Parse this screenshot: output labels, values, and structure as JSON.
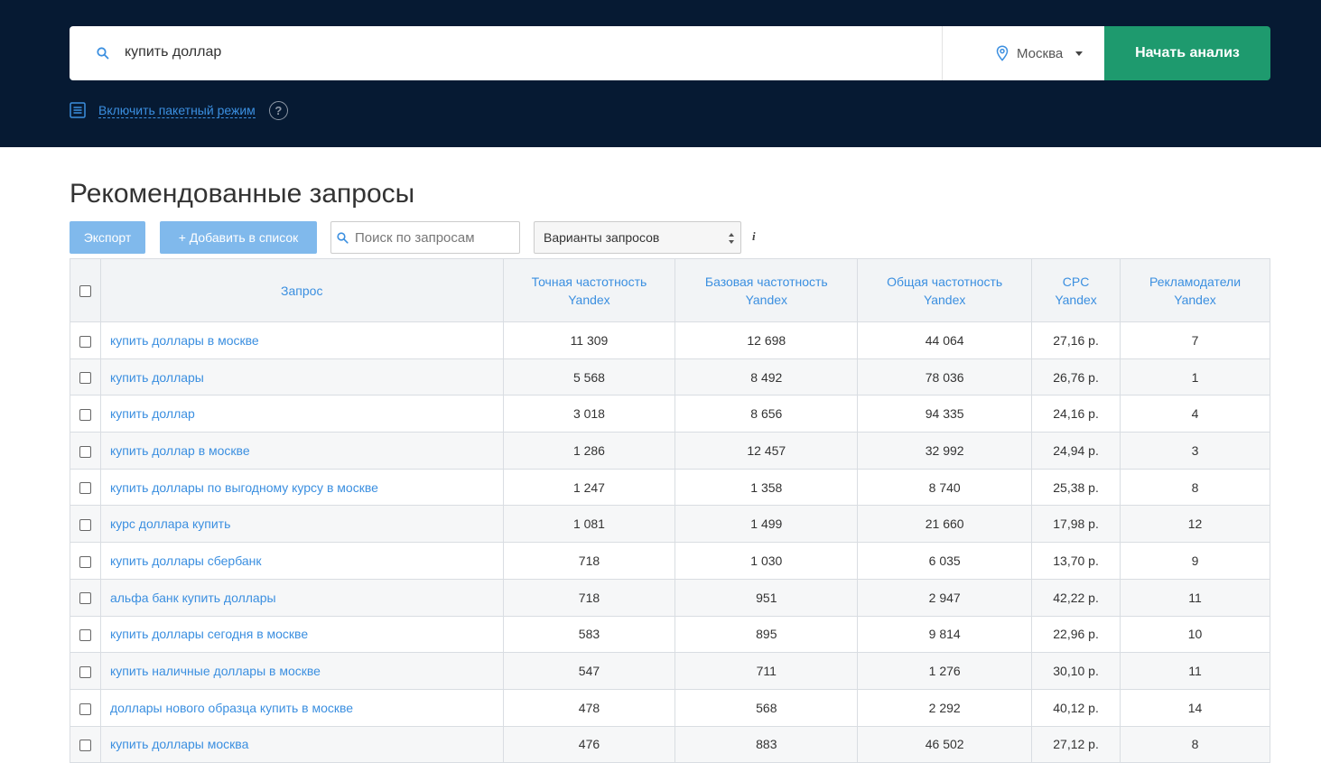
{
  "header": {
    "search_query": "купить доллар",
    "region": "Москва",
    "start_button": "Начать анализ",
    "batch_mode_link": "Включить пакетный режим",
    "help_symbol": "?"
  },
  "section": {
    "title": "Рекомендованные запросы"
  },
  "toolbar": {
    "export_label": "Экспорт",
    "add_to_list_label": "+ Добавить в список",
    "filter_placeholder": "Поиск по запросам",
    "variants_selected": "Варианты запросов",
    "info_symbol": "i"
  },
  "table": {
    "columns": {
      "query": "Запрос",
      "exact_line1": "Точная частотность",
      "exact_line2": "Yandex",
      "base_line1": "Базовая частотность",
      "base_line2": "Yandex",
      "total_line1": "Общая частотность",
      "total_line2": "Yandex",
      "cpc_line1": "CPC",
      "cpc_line2": "Yandex",
      "ads_line1": "Рекламодатели",
      "ads_line2": "Yandex"
    },
    "rows": [
      {
        "query": "купить доллары в москве",
        "exact": "11 309",
        "base": "12 698",
        "total": "44 064",
        "cpc": "27,16 р.",
        "ads": "7"
      },
      {
        "query": "купить доллары",
        "exact": "5 568",
        "base": "8 492",
        "total": "78 036",
        "cpc": "26,76 р.",
        "ads": "1"
      },
      {
        "query": "купить доллар",
        "exact": "3 018",
        "base": "8 656",
        "total": "94 335",
        "cpc": "24,16 р.",
        "ads": "4"
      },
      {
        "query": "купить доллар в москве",
        "exact": "1 286",
        "base": "12 457",
        "total": "32 992",
        "cpc": "24,94 р.",
        "ads": "3"
      },
      {
        "query": "купить доллары по выгодному курсу в москве",
        "exact": "1 247",
        "base": "1 358",
        "total": "8 740",
        "cpc": "25,38 р.",
        "ads": "8"
      },
      {
        "query": "курс доллара купить",
        "exact": "1 081",
        "base": "1 499",
        "total": "21 660",
        "cpc": "17,98 р.",
        "ads": "12"
      },
      {
        "query": "купить доллары сбербанк",
        "exact": "718",
        "base": "1 030",
        "total": "6 035",
        "cpc": "13,70 р.",
        "ads": "9"
      },
      {
        "query": "альфа банк купить доллары",
        "exact": "718",
        "base": "951",
        "total": "2 947",
        "cpc": "42,22 р.",
        "ads": "11"
      },
      {
        "query": "купить доллары сегодня в москве",
        "exact": "583",
        "base": "895",
        "total": "9 814",
        "cpc": "22,96 р.",
        "ads": "10"
      },
      {
        "query": "купить наличные доллары в москве",
        "exact": "547",
        "base": "711",
        "total": "1 276",
        "cpc": "30,10 р.",
        "ads": "11"
      },
      {
        "query": "доллары нового образца купить в москве",
        "exact": "478",
        "base": "568",
        "total": "2 292",
        "cpc": "40,12 р.",
        "ads": "14"
      },
      {
        "query": "купить доллары москва",
        "exact": "476",
        "base": "883",
        "total": "46 502",
        "cpc": "27,12 р.",
        "ads": "8"
      }
    ]
  },
  "colors": {
    "header_bg": "#061a33",
    "accent_green": "#1e9a6e",
    "link_blue": "#3b8fe0",
    "button_blue": "#80b9ec"
  },
  "icons": {
    "search": "search-icon",
    "location": "location-pin-icon",
    "dropdown": "chevron-down-icon",
    "batch": "list-icon",
    "help": "help-icon",
    "info": "info-icon"
  }
}
